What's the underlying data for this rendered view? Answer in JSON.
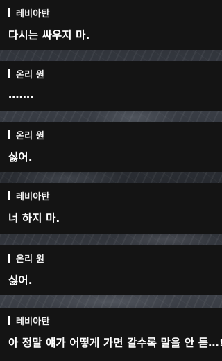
{
  "dialogues": [
    {
      "speaker": "레비아탄",
      "text": "다시는 싸우지 마."
    },
    {
      "speaker": "온리 원",
      "text": "……."
    },
    {
      "speaker": "온리 원",
      "text": "싫어."
    },
    {
      "speaker": "레비아탄",
      "text": "너 하지 마."
    },
    {
      "speaker": "온리 원",
      "text": "싫어."
    },
    {
      "speaker": "레비아탄",
      "text": "아 정말 얘가 어떻게 가면 갈수록 말을 안 듣…!"
    }
  ]
}
